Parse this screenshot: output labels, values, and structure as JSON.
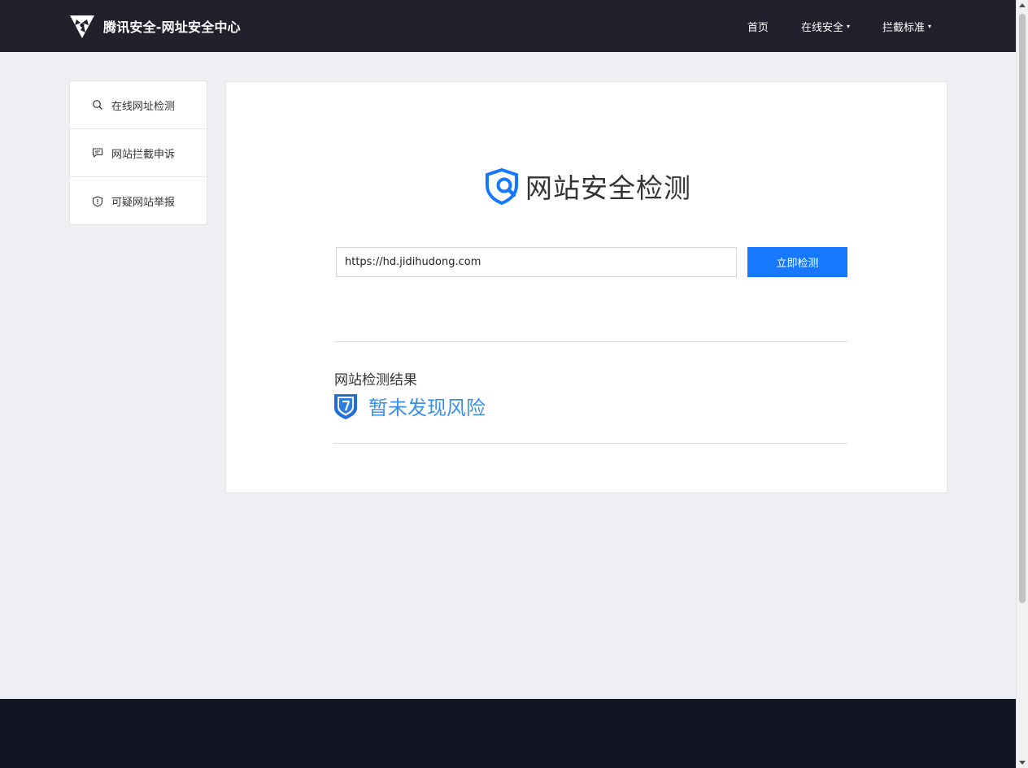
{
  "header": {
    "title": "腾讯安全-网址安全中心",
    "logo_icon": "tencent-security-logo",
    "nav": [
      {
        "label": "首页",
        "has_dropdown": false
      },
      {
        "label": "在线安全",
        "has_dropdown": true
      },
      {
        "label": "拦截标准",
        "has_dropdown": true
      }
    ],
    "caret": "▾"
  },
  "sidebar": {
    "items": [
      {
        "label": "在线网址检测",
        "icon": "search-icon"
      },
      {
        "label": "网站拦截申诉",
        "icon": "message-icon"
      },
      {
        "label": "可疑网站举报",
        "icon": "shield-alert-icon"
      }
    ]
  },
  "main": {
    "title": "网站安全检测",
    "title_icon": "shield-search-icon",
    "url_input": {
      "value": "https://hd.jidihudong.com",
      "placeholder": ""
    },
    "check_button": "立即检测",
    "result_heading": "网站检测结果",
    "result_status": "暂未发现风险",
    "result_icon": "shield-question-icon"
  },
  "colors": {
    "header_bg": "#20212c",
    "page_bg": "#efeff3",
    "accent": "#1677ff",
    "result_text": "#3b8fe8",
    "footer_bg": "#131522"
  }
}
